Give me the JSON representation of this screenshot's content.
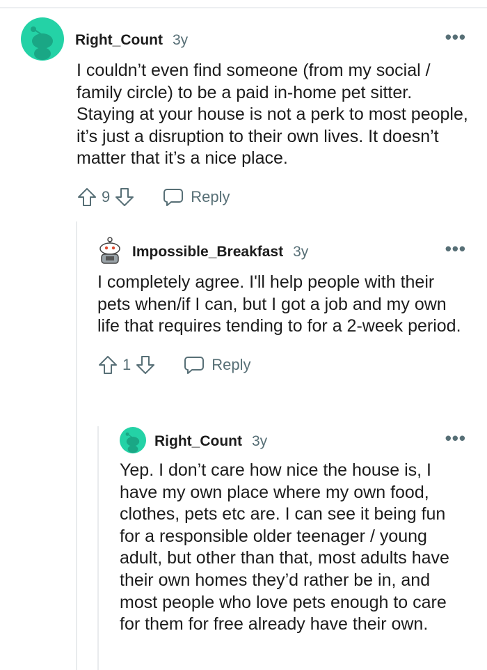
{
  "comments": [
    {
      "author": "Right_Count",
      "age": "3y",
      "avatar": "snoo-avatar-teal",
      "body": "I couldn’t even find someone (from my social / family circle) to be a paid in-home pet sitter. Staying at your house is not a perk to most people, it’s just a disruption to their own lives. It doesn’t matter that it’s a nice place.",
      "votes": "9",
      "reply_label": "Reply"
    },
    {
      "author": "Impossible_Breakfast",
      "age": "3y",
      "avatar": "snoo-avatar-custom",
      "body": "I completely agree. I'll help people with their pets when/if I can, but I got a job and my own life that requires tending to for a 2-week period.",
      "votes": "1",
      "reply_label": "Reply"
    },
    {
      "author": "Right_Count",
      "age": "3y",
      "avatar": "snoo-avatar-teal",
      "body": "Yep. I don’t care how nice the house is, I have my own place where my own food, clothes, pets etc are. I can see it being fun for a responsible older teenager / young adult, but other than that, most adults have their own homes they’d rather be in, and most people who love pets enough to care for them for free already have their own."
    }
  ],
  "more_options": "•••",
  "colors": {
    "avatar_teal": "#24d2a6",
    "meta_gray": "#576f76",
    "thread_line": "#e9ebed"
  }
}
